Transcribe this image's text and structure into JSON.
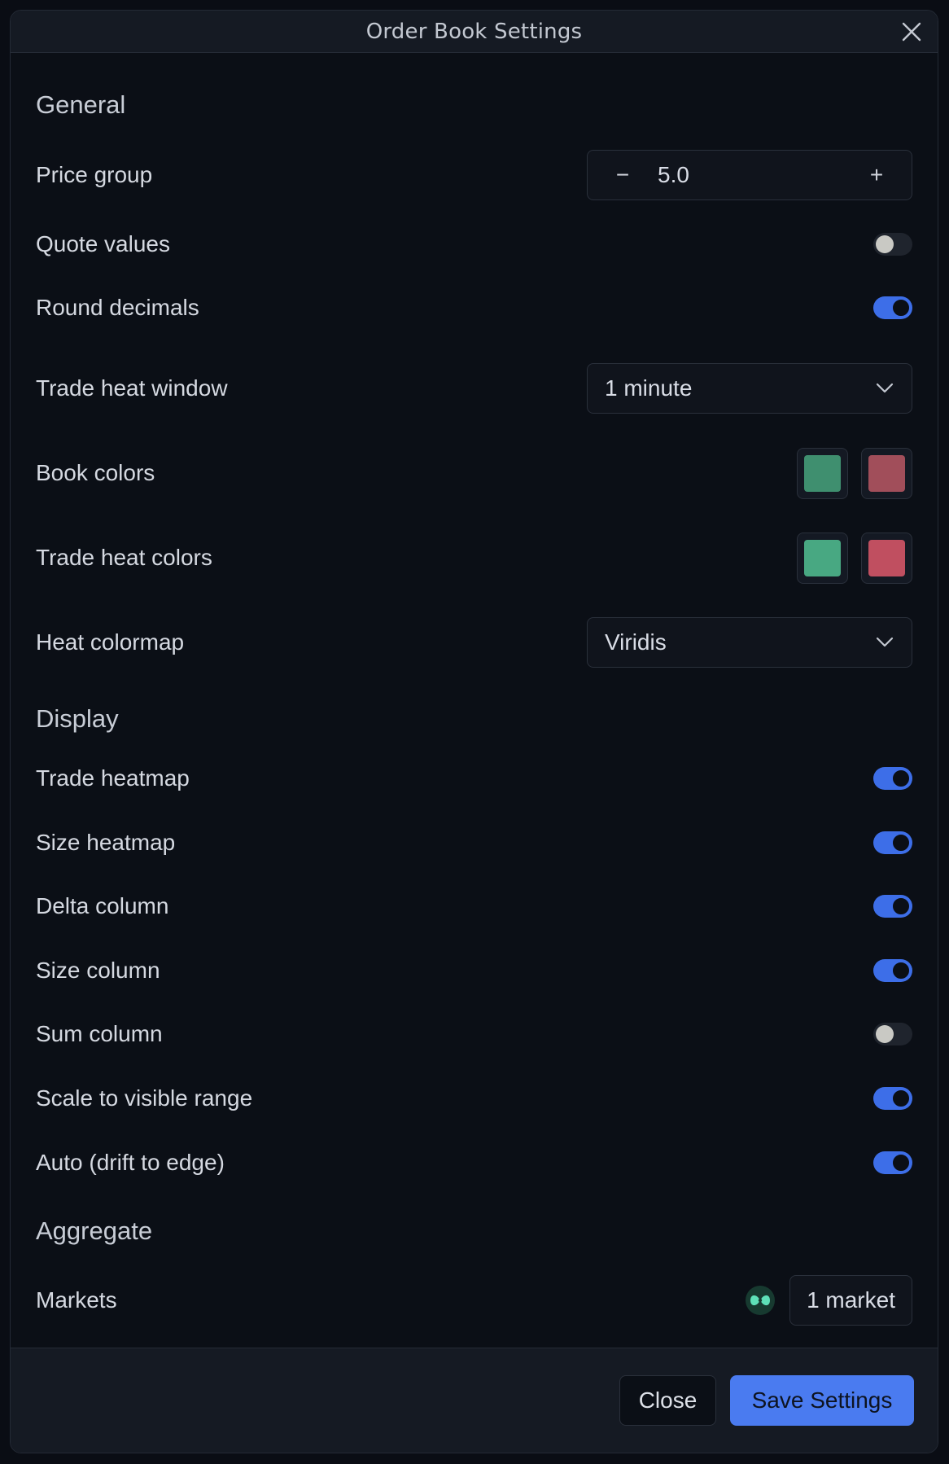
{
  "window": {
    "title": "Order Book Settings"
  },
  "sections": {
    "general": "General",
    "display": "Display",
    "aggregate": "Aggregate"
  },
  "general": {
    "price_group": {
      "label": "Price group",
      "value": "5.0",
      "minus": "−",
      "plus": "+"
    },
    "quote_values": {
      "label": "Quote values",
      "on": false
    },
    "round_decimals": {
      "label": "Round decimals",
      "on": true
    },
    "trade_heat_window": {
      "label": "Trade heat window",
      "value": "1 minute"
    },
    "book_colors": {
      "label": "Book colors",
      "colors": [
        "#3f8f6f",
        "#a14e5a"
      ]
    },
    "trade_heat_colors": {
      "label": "Trade heat colors",
      "colors": [
        "#48a882",
        "#c04f60"
      ]
    },
    "heat_colormap": {
      "label": "Heat colormap",
      "value": "Viridis"
    }
  },
  "display": {
    "trade_heatmap": {
      "label": "Trade heatmap",
      "on": true
    },
    "size_heatmap": {
      "label": "Size heatmap",
      "on": true
    },
    "delta_column": {
      "label": "Delta column",
      "on": true
    },
    "size_column": {
      "label": "Size column",
      "on": true
    },
    "sum_column": {
      "label": "Sum column",
      "on": false
    },
    "scale_visible": {
      "label": "Scale to visible range",
      "on": true
    },
    "auto_drift": {
      "label": "Auto (drift to edge)",
      "on": true
    }
  },
  "aggregate": {
    "markets": {
      "label": "Markets",
      "value": "1 market",
      "icon": "exchange-logo-icon"
    }
  },
  "footer": {
    "close_label": "Close",
    "save_label": "Save Settings"
  },
  "colors": {
    "accent": "#4a7bf0",
    "toggle_on": "#3d6ee8",
    "market_icon": "#5ee0b8"
  }
}
